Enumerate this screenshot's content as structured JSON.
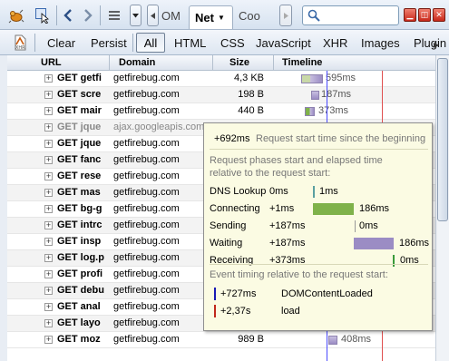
{
  "toolbar": {
    "panel_tab_prev": "OM",
    "active_tab": "Net",
    "panel_tab_next": "Coo",
    "search_placeholder": "",
    "icons": [
      "firebug-icon",
      "inspect-icon",
      "back-icon",
      "forward-icon",
      "menu-icon",
      "search-icon",
      "minimize-icon",
      "restore-icon",
      "close-icon"
    ]
  },
  "filters": {
    "clear": "Clear",
    "persist": "Persist",
    "items": [
      "All",
      "HTML",
      "CSS",
      "JavaScript",
      "XHR",
      "Images",
      "Plugin"
    ],
    "selected": "All"
  },
  "table": {
    "headers": {
      "url": "URL",
      "domain": "Domain",
      "size": "Size",
      "timeline": "Timeline"
    },
    "rows": [
      {
        "url": "GET getfi",
        "domain": "getfirebug.com",
        "size": "4,3 KB",
        "time": "595ms",
        "dim": false
      },
      {
        "url": "GET scre",
        "domain": "getfirebug.com",
        "size": "198 B",
        "time": "187ms",
        "dim": false
      },
      {
        "url": "GET mair",
        "domain": "getfirebug.com",
        "size": "440 B",
        "time": "373ms",
        "dim": false
      },
      {
        "url": "GET jque",
        "domain": "ajax.googleapis.com",
        "size": "",
        "time": "",
        "dim": true
      },
      {
        "url": "GET jque",
        "domain": "getfirebug.com",
        "size": "",
        "time": "",
        "dim": false
      },
      {
        "url": "GET fanc",
        "domain": "getfirebug.com",
        "size": "",
        "time": "",
        "dim": false
      },
      {
        "url": "GET rese",
        "domain": "getfirebug.com",
        "size": "",
        "time": "",
        "dim": false
      },
      {
        "url": "GET mas",
        "domain": "getfirebug.com",
        "size": "",
        "time": "",
        "dim": false
      },
      {
        "url": "GET bg-g",
        "domain": "getfirebug.com",
        "size": "",
        "time": "",
        "dim": false
      },
      {
        "url": "GET intrc",
        "domain": "getfirebug.com",
        "size": "",
        "time": "",
        "dim": false
      },
      {
        "url": "GET insp",
        "domain": "getfirebug.com",
        "size": "",
        "time": "",
        "dim": false
      },
      {
        "url": "GET log.p",
        "domain": "getfirebug.com",
        "size": "",
        "time": "",
        "dim": false
      },
      {
        "url": "GET profi",
        "domain": "getfirebug.com",
        "size": "",
        "time": "",
        "dim": false
      },
      {
        "url": "GET debu",
        "domain": "getfirebug.com",
        "size": "",
        "time": "",
        "dim": false
      },
      {
        "url": "GET anal",
        "domain": "getfirebug.com",
        "size": "",
        "time": "",
        "dim": false
      },
      {
        "url": "GET layo",
        "domain": "getfirebug.com",
        "size": "",
        "time": "",
        "dim": false
      },
      {
        "url": "GET moz",
        "domain": "getfirebug.com",
        "size": "989 B",
        "time": "408ms",
        "dim": false
      }
    ]
  },
  "tooltip": {
    "start_value": "+692ms",
    "start_label": "Request start time since the beginning",
    "phases_title_1": "Request phases start and elapsed time",
    "phases_title_2": "relative to the request start:",
    "phases": [
      {
        "name": "DNS Lookup",
        "start": "0ms",
        "elapsed": "1ms"
      },
      {
        "name": "Connecting",
        "start": "+1ms",
        "elapsed": "186ms"
      },
      {
        "name": "Sending",
        "start": "+187ms",
        "elapsed": "0ms"
      },
      {
        "name": "Waiting",
        "start": "+187ms",
        "elapsed": "186ms"
      },
      {
        "name": "Receiving",
        "start": "+373ms",
        "elapsed": "0ms"
      }
    ],
    "events_title": "Event timing relative to the request start:",
    "events": [
      {
        "time": "+727ms",
        "name": "DOMContentLoaded",
        "color": "#1a1ab4"
      },
      {
        "time": "+2,37s",
        "name": "load",
        "color": "#c0281a"
      }
    ]
  },
  "colors": {
    "connecting": "#7fb24a",
    "waiting": "#9b8cc4",
    "dns": "#5aa0a0",
    "receiving": "#3a9a3a"
  }
}
